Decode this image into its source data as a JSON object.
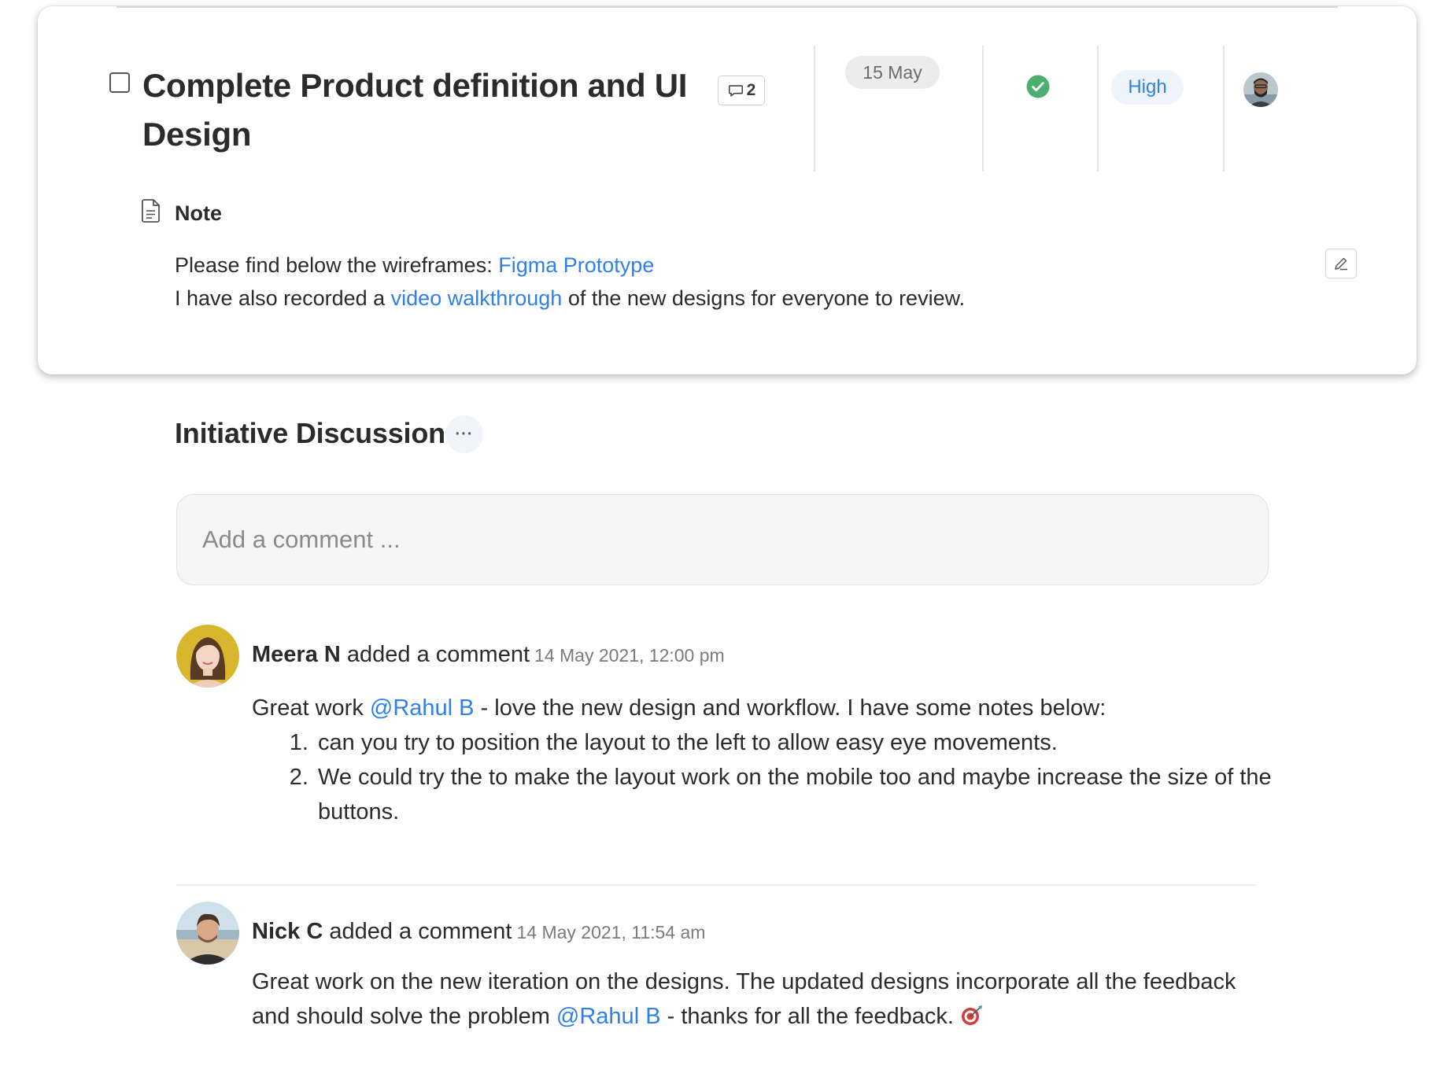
{
  "task": {
    "title": "Complete Product definition and UI Design",
    "comment_count": "2",
    "due_date": "15 May",
    "status_icon": "check-circle-icon",
    "status_color": "#4caf6f",
    "priority": "High",
    "assignee_avatar": "avatar"
  },
  "note": {
    "label": "Note",
    "line1_text": "Please find below the wireframes: ",
    "line1_link": "Figma Prototype",
    "line2_before": "I have also recorded a ",
    "line2_link": "video walkthrough",
    "line2_after": " of the new designs for everyone to review."
  },
  "discussion": {
    "title": "Initiative Discussion",
    "more_label": "···",
    "input_placeholder": "Add a comment ..."
  },
  "comments": [
    {
      "author": "Meera N",
      "action": " added a comment",
      "timestamp": "14 May 2021, 12:00 pm",
      "body_before": "Great work ",
      "mention": "@Rahul B",
      "body_after": " - love the new design and workflow. I have some notes below:",
      "list": [
        "can you try to position the layout to the left to allow easy eye movements.",
        "We could try the to make the layout work on the mobile too and maybe increase the size of the buttons."
      ]
    },
    {
      "author": "Nick C",
      "action": " added a comment",
      "timestamp": "14 May 2021, 11:54 am",
      "body_before": "Great work on the new iteration on the designs. The updated designs incorporate all the feedback and should solve the problem ",
      "mention": "@Rahul B",
      "body_after": " - thanks for all the feedback. ",
      "emoji": "direct-hit-icon"
    }
  ],
  "colors": {
    "link": "#2f80ed",
    "priority_bg": "#eef4fc",
    "date_bg": "#ececec"
  }
}
